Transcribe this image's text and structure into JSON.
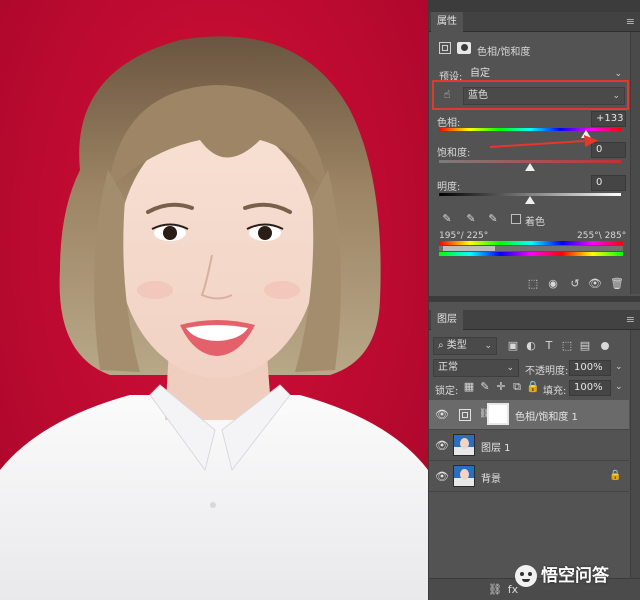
{
  "properties_panel": {
    "tab_label": "属性",
    "header_title": "色相/饱和度",
    "preset_label": "预设:",
    "preset_value": "自定",
    "channel_value": "蓝色",
    "hue_label": "色相:",
    "hue_value": "+133",
    "saturation_label": "饱和度:",
    "saturation_value": "0",
    "lightness_label": "明度:",
    "lightness_value": "0",
    "colorize_label": "着色",
    "range_left": "195°/ 225°",
    "range_right": "255°\\ 285°",
    "hue_slider_level": 0.81,
    "saturation_slider_level": 0.5,
    "lightness_slider_level": 0.5
  },
  "layers_panel": {
    "tab_label": "图层",
    "filter_kind": "类型",
    "blend_mode": "正常",
    "opacity_label": "不透明度:",
    "opacity_value": "100%",
    "lock_label": "锁定:",
    "fill_label": "填充:",
    "fill_value": "100%",
    "layers": [
      {
        "name": "色相/饱和度 1",
        "type": "adjustment"
      },
      {
        "name": "图层 1",
        "type": "photo"
      },
      {
        "name": "背景",
        "type": "photo-locked"
      }
    ]
  },
  "watermark": {
    "text": "悟空问答"
  },
  "colors": {
    "panel_bg": "#535353",
    "canvas_red": "#c40e33",
    "highlight_box": "#e03a2e",
    "arrow": "#e8362a"
  }
}
